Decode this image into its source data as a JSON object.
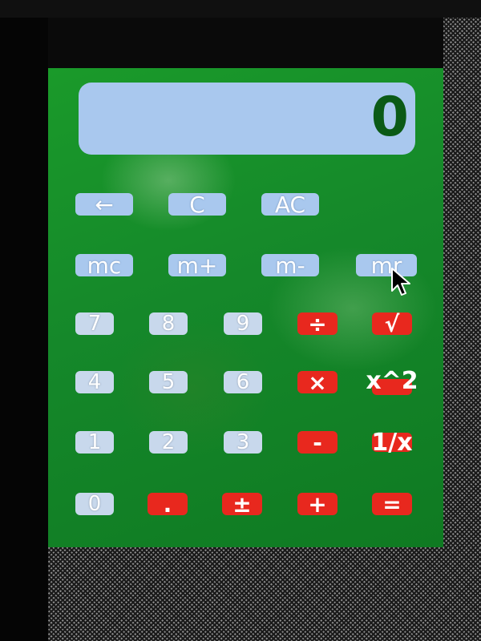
{
  "display": {
    "value": "0"
  },
  "buttons": {
    "backspace": "←",
    "clear": "C",
    "all_clear": "AC",
    "mem_clear": "mc",
    "mem_add": "m+",
    "mem_sub": "m-",
    "mem_recall": "mr",
    "d7": "7",
    "d8": "8",
    "d9": "9",
    "divide": "÷",
    "sqrt": "√",
    "d4": "4",
    "d5": "5",
    "d6": "6",
    "multiply": "×",
    "square": "x^2",
    "d1": "1",
    "d2": "2",
    "d3": "3",
    "minus": "-",
    "reciprocal": "1/x",
    "d0": "0",
    "decimal": ".",
    "plus_minus": "±",
    "plus": "+",
    "equals": "="
  },
  "colors": {
    "display_bg": "#a9c8ee",
    "display_text": "#0b5a16",
    "operator_red": "#e8281e",
    "window_green": "#15882a"
  },
  "icons": {
    "pointer": "mouse-pointer-icon"
  }
}
